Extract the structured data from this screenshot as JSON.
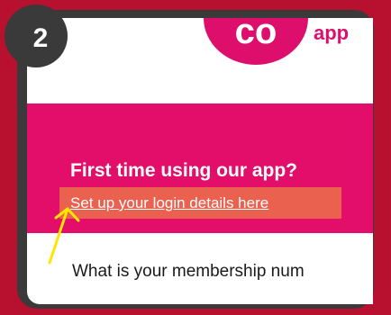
{
  "step": {
    "number": "2"
  },
  "header": {
    "logo_text": "co",
    "app_word": "app"
  },
  "banner": {
    "headline": "First time using our app?",
    "link_text": "Set up your login details here"
  },
  "form": {
    "question": "What is your membership num"
  },
  "colors": {
    "background_red": "#b8102f",
    "brand_pink": "#e30e6a",
    "link_highlight": "#ea6150",
    "frame_dark": "#3a3a3a",
    "arrow_yellow": "#ffe600"
  },
  "annotation": {
    "arrow": "arrow-pointing-to-link"
  }
}
